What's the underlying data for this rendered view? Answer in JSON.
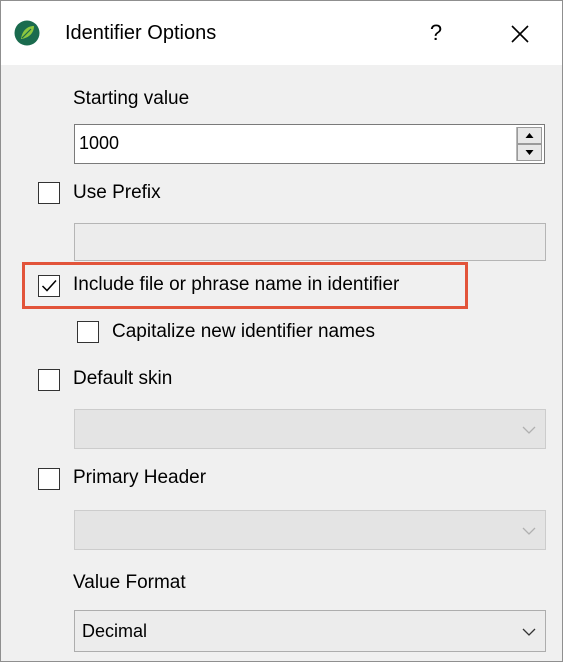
{
  "window": {
    "title": "Identifier Options",
    "help_label": "?",
    "app_icon": "leaf-logo-icon",
    "close_icon": "close-icon"
  },
  "starting_value": {
    "label": "Starting value",
    "value": "1000"
  },
  "use_prefix": {
    "label": "Use Prefix",
    "checked": false,
    "value": ""
  },
  "include_name": {
    "label": "Include file or phrase name in identifier",
    "checked": true,
    "highlight_color": "#e2543a"
  },
  "capitalize": {
    "label": "Capitalize new identifier names",
    "checked": false
  },
  "default_skin": {
    "label": "Default skin",
    "checked": false,
    "value": ""
  },
  "primary_header": {
    "label": "Primary Header",
    "checked": false,
    "value": ""
  },
  "value_format": {
    "label": "Value Format",
    "selected": "Decimal"
  },
  "colors": {
    "dialog_bg": "#f0f0f0",
    "titlebar_bg": "#ffffff",
    "logo_dark": "#1a6b4e",
    "logo_light": "#8cc63f"
  }
}
